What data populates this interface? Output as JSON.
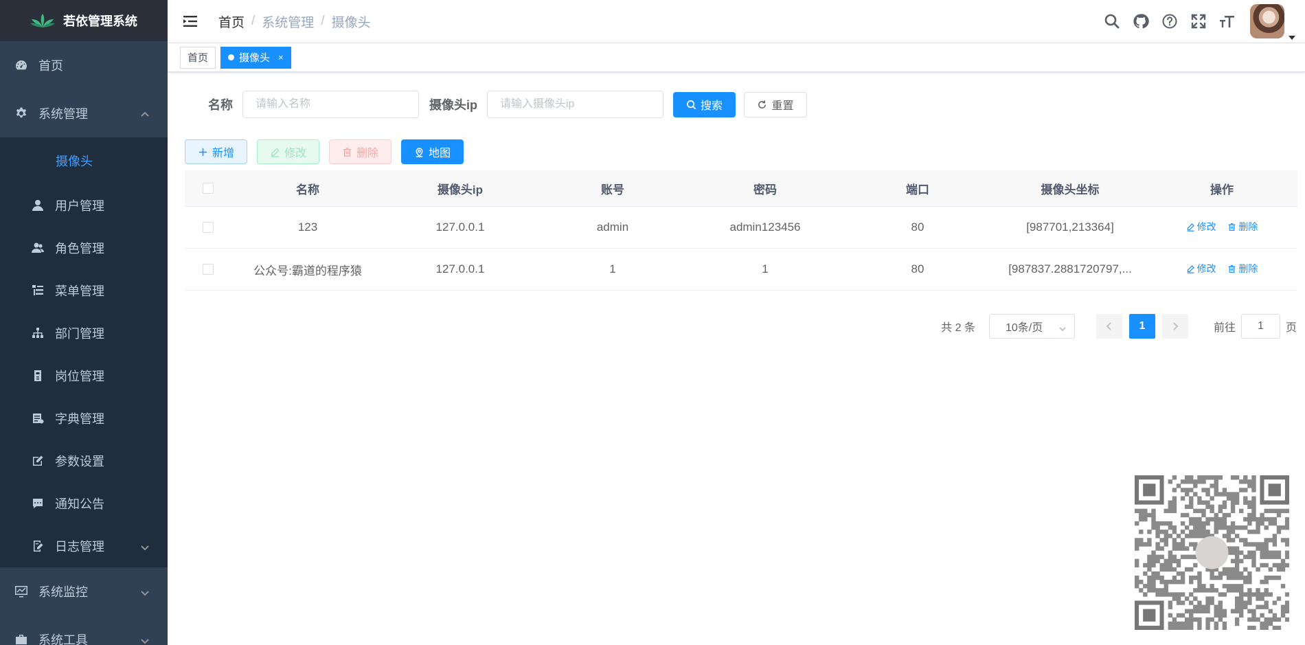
{
  "app": {
    "title": "若依管理系统"
  },
  "sidebar": {
    "items": [
      {
        "label": "首页",
        "icon": "dashboard-icon"
      },
      {
        "label": "系统管理",
        "icon": "system-gear-icon",
        "expanded": true,
        "children": [
          {
            "label": "摄像头",
            "active": true
          },
          {
            "label": "用户管理",
            "icon": "user-icon"
          },
          {
            "label": "角色管理",
            "icon": "peoples-icon"
          },
          {
            "label": "菜单管理",
            "icon": "tree-table-icon"
          },
          {
            "label": "部门管理",
            "icon": "tree-icon"
          },
          {
            "label": "岗位管理",
            "icon": "post-icon"
          },
          {
            "label": "字典管理",
            "icon": "dict-icon"
          },
          {
            "label": "参数设置",
            "icon": "edit-icon"
          },
          {
            "label": "通知公告",
            "icon": "message-icon"
          },
          {
            "label": "日志管理",
            "icon": "log-icon"
          }
        ]
      },
      {
        "label": "系统监控",
        "icon": "monitor-icon"
      },
      {
        "label": "系统工具",
        "icon": "tool-icon"
      }
    ]
  },
  "breadcrumb": [
    "首页",
    "系统管理",
    "摄像头"
  ],
  "header_icons": [
    "search-icon",
    "github-icon",
    "question-icon",
    "fullscreen-icon",
    "font-size-icon"
  ],
  "tags": [
    {
      "label": "首页",
      "active": false
    },
    {
      "label": "摄像头",
      "active": true,
      "close": "×"
    }
  ],
  "search": {
    "name_label": "名称",
    "name_placeholder": "请输入名称",
    "ip_label": "摄像头ip",
    "ip_placeholder": "请输入摄像头ip",
    "search_btn": "搜索",
    "reset_btn": "重置"
  },
  "toolbar": {
    "add": "新增",
    "edit": "修改",
    "delete": "删除",
    "map": "地图"
  },
  "table": {
    "columns": [
      "名称",
      "摄像头ip",
      "账号",
      "密码",
      "端口",
      "摄像头坐标",
      "操作"
    ],
    "rows": [
      {
        "name": "123",
        "ip": "127.0.0.1",
        "account": "admin",
        "password": "admin123456",
        "port": "80",
        "coords": "[987701,213364]"
      },
      {
        "name": "公众号:霸道的程序猿",
        "ip": "127.0.0.1",
        "account": "1",
        "password": "1",
        "port": "80",
        "coords": "[987837.2881720797,..."
      }
    ],
    "row_actions": {
      "edit": "修改",
      "delete": "删除"
    }
  },
  "pagination": {
    "total": "共 2 条",
    "page_size": "10条/页",
    "current_page": "1",
    "goto_label": "前往",
    "goto_value": "1",
    "page_suffix": "页"
  },
  "colors": {
    "sidebar_bg": "#304156",
    "submenu_bg": "#1f2d3d",
    "primary": "#1890ff",
    "active_menu_text": "#409eff"
  }
}
